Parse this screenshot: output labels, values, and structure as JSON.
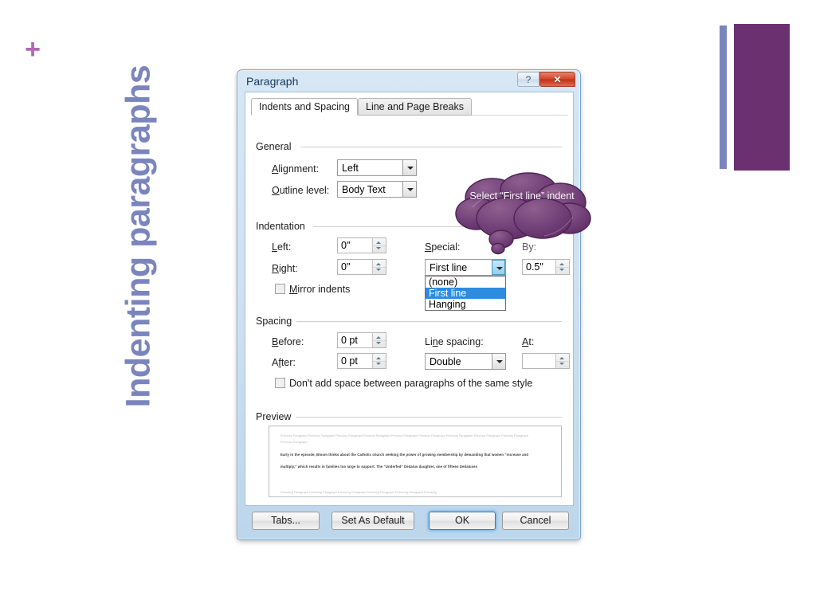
{
  "slide": {
    "title": "Indenting paragraphs",
    "plus_marker": "+",
    "accent_color": "#7b85bd",
    "bar_color": "#6b3070",
    "plus_color": "#b06ab0"
  },
  "callout": {
    "text": "Select “First line” indent",
    "fill_color": "#6e3a6e"
  },
  "dialog": {
    "title": "Paragraph",
    "help_button": "?",
    "close_button": "✕",
    "tabs": [
      {
        "label": "Indents and Spacing",
        "active": true
      },
      {
        "label": "Line and Page Breaks",
        "active": false
      }
    ],
    "general": {
      "group_label": "General",
      "alignment_label": "Alignment:",
      "alignment_value": "Left",
      "outline_label": "Outline level:",
      "outline_value": "Body Text"
    },
    "indentation": {
      "group_label": "Indentation",
      "left_label": "Left:",
      "left_value": "0\"",
      "right_label": "Right:",
      "right_value": "0\"",
      "mirror_label": "Mirror indents",
      "mirror_checked": false,
      "special_label": "Special:",
      "special_value": "First line",
      "by_label": "By:",
      "by_value": "0.5\"",
      "dropdown_open": true,
      "dropdown_options": [
        "(none)",
        "First line",
        "Hanging"
      ],
      "dropdown_selected": "First line",
      "highlight_color": "#2d8ce0"
    },
    "spacing": {
      "group_label": "Spacing",
      "before_label": "Before:",
      "before_value": "0 pt",
      "after_label": "After:",
      "after_value": "0 pt",
      "line_spacing_label": "Line spacing:",
      "line_spacing_value": "Double",
      "at_label": "At:",
      "at_value": "",
      "dont_add_label": "Don't add space between paragraphs of the same style",
      "dont_add_checked": false
    },
    "preview": {
      "group_label": "Preview",
      "previous_text": "Previous Paragraph Previous Paragraph Previous Paragraph Previous Paragraph Previous Paragraph Previous Paragraph Previous Paragraph Previous Paragraph Previous Paragraph Previous Paragraph",
      "body_text": "Early in the episode, Bloom thinks about the Catholic church seeking the power of growing membership by demanding that women “increase and multiply,” which results in families too large to support. The “Underfed” Dedalus daughter, one of fifteen Dedaluses",
      "following_text": "Following Paragraph Following Paragraph Following Paragraph Following Paragraph Following Paragraph Following"
    },
    "footer": {
      "tabs_button": "Tabs...",
      "set_default_button": "Set As Default",
      "ok_button": "OK",
      "cancel_button": "Cancel",
      "default_button": "OK"
    }
  }
}
